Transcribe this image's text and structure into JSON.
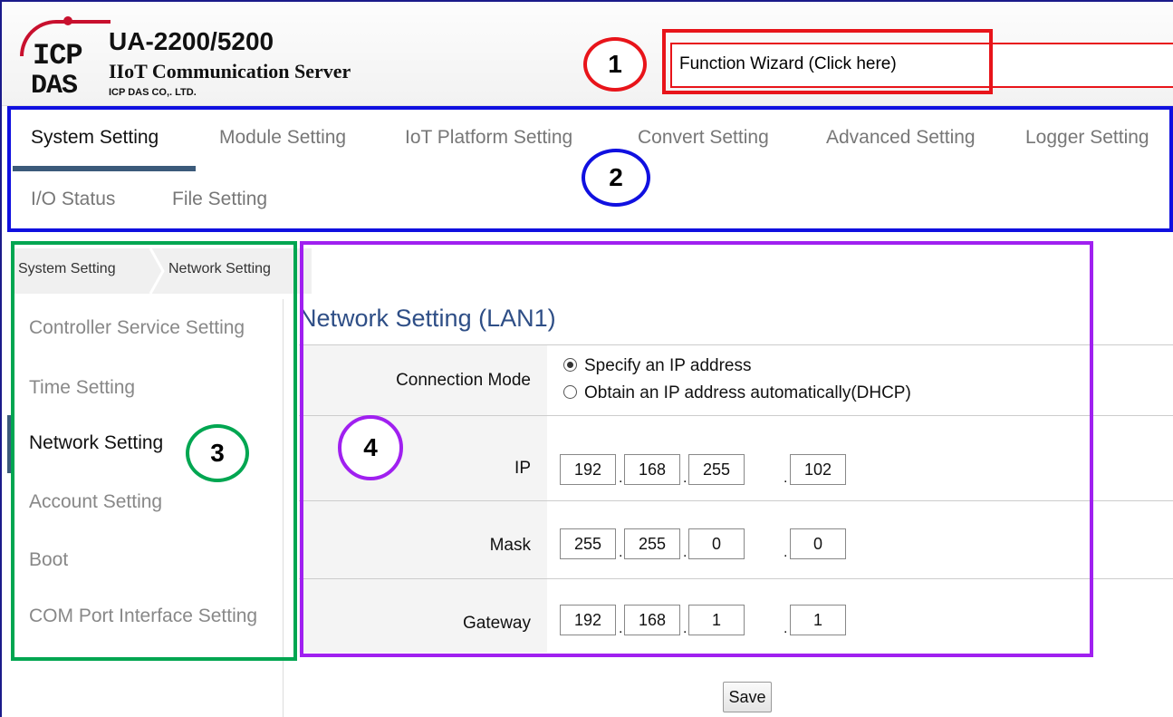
{
  "header": {
    "logo_top": "ICP",
    "logo_bottom": "DAS",
    "product_title": "UA-2200/5200",
    "product_subtitle": "IIoT Communication Server",
    "company": "ICP DAS CO,. LTD.",
    "wizard_value": "Function Wizard  (Click here)"
  },
  "nav": {
    "tabs": [
      {
        "label": "System Setting",
        "active": true
      },
      {
        "label": "Module Setting"
      },
      {
        "label": "IoT Platform Setting"
      },
      {
        "label": "Convert Setting"
      },
      {
        "label": "Advanced Setting"
      },
      {
        "label": "Logger Setting"
      },
      {
        "label": "I/O Status"
      },
      {
        "label": "File Setting"
      }
    ]
  },
  "breadcrumb": [
    "System Setting",
    "Network Setting"
  ],
  "sidebar": {
    "items": [
      {
        "label": "Controller Service Setting"
      },
      {
        "label": "Time Setting"
      },
      {
        "label": "Network Setting",
        "active": true
      },
      {
        "label": "Account Setting"
      },
      {
        "label": "Boot"
      },
      {
        "label": "COM Port Interface Setting"
      }
    ]
  },
  "main": {
    "title": "Network Setting (LAN1)",
    "connection_mode": {
      "label": "Connection Mode",
      "options": [
        "Specify an IP address",
        "Obtain an IP address automatically(DHCP)"
      ],
      "selected_index": 0
    },
    "ip": {
      "label": "IP",
      "octets": [
        "192",
        "168",
        "255",
        "102"
      ]
    },
    "mask": {
      "label": "Mask",
      "octets": [
        "255",
        "255",
        "0",
        "0"
      ]
    },
    "gateway": {
      "label": "Gateway",
      "octets": [
        "192",
        "168",
        "1",
        "1"
      ]
    },
    "save_label": "Save"
  },
  "annotations": {
    "one": "1",
    "two": "2",
    "three": "3",
    "four": "4"
  },
  "colors": {
    "annotation_1": "#e8141a",
    "annotation_2": "#1010e0",
    "annotation_3": "#00a651",
    "annotation_4": "#a020f0",
    "title_blue": "#2e4e86",
    "accent_bar": "#3b5a7a"
  }
}
